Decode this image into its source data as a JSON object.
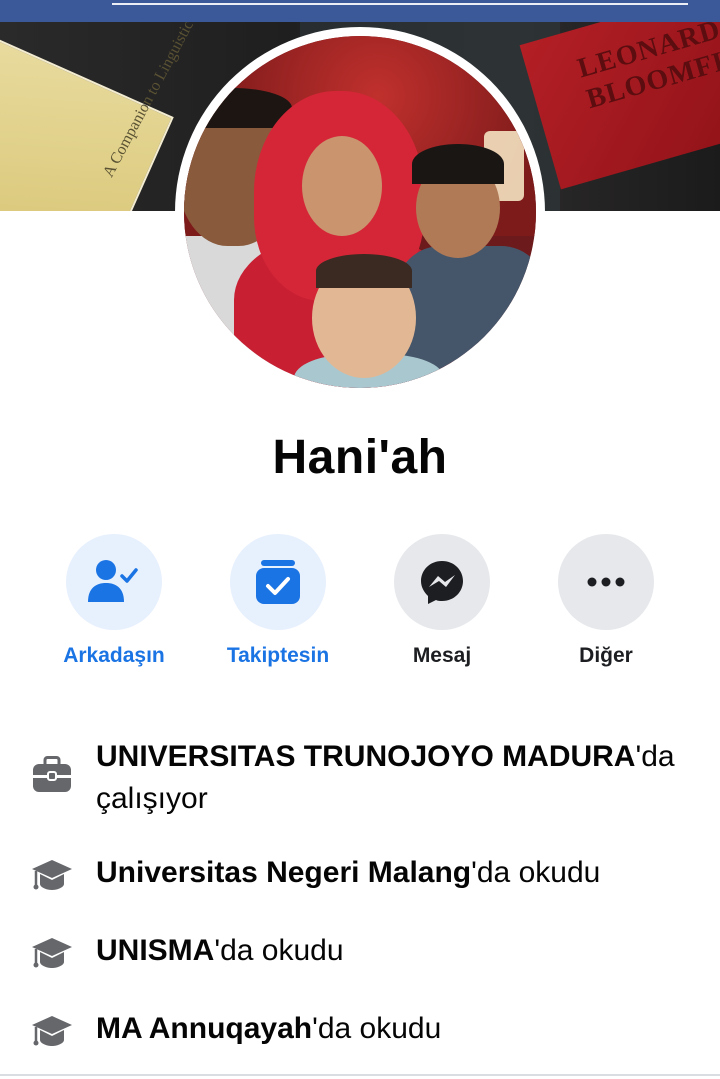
{
  "cover": {
    "book_left_title": "A Companion to Linguistic Anthropology",
    "book_right_title": "LEONARD BLOOMFIELD"
  },
  "profile": {
    "name": "Hani'ah"
  },
  "actions": [
    {
      "label": "Arkadaşın",
      "icon": "friends-check-icon"
    },
    {
      "label": "Takiptesin",
      "icon": "following-check-icon"
    },
    {
      "label": "Mesaj",
      "icon": "messenger-icon"
    },
    {
      "label": "Diğer",
      "icon": "more-dots-icon"
    }
  ],
  "info": [
    {
      "icon": "briefcase-icon",
      "bold": "UNIVERSITAS TRUNOJOYO MADURA",
      "rest": "'da çalışıyor"
    },
    {
      "icon": "graduation-cap-icon",
      "bold": "Universitas Negeri Malang",
      "rest": "'da okudu"
    },
    {
      "icon": "graduation-cap-icon",
      "bold": "UNISMA",
      "rest": "'da okudu"
    },
    {
      "icon": "graduation-cap-icon",
      "bold": "MA Annuqayah",
      "rest": "'da okudu"
    }
  ],
  "colors": {
    "accent": "#1b74e4",
    "top_bar": "#3b5998",
    "icon_grey": "#65676b"
  }
}
